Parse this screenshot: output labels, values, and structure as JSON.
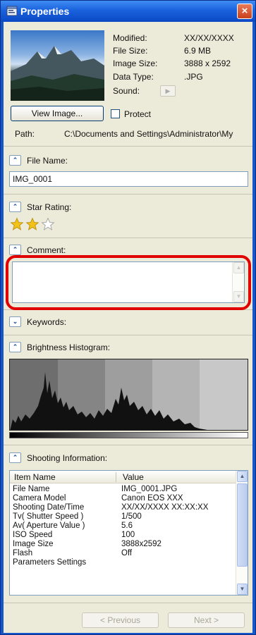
{
  "window": {
    "title": "Properties",
    "close_glyph": "×",
    "icon": "properties-app-icon",
    "accent": "#1656c8"
  },
  "meta": {
    "modified_label": "Modified:",
    "modified_value": "XX/XX/XXXX",
    "filesize_label": "File Size:",
    "filesize_value": "6.9 MB",
    "imagesize_label": "Image Size:",
    "imagesize_value": "3888 x 2592",
    "datatype_label": "Data Type:",
    "datatype_value": ".JPG",
    "sound_label": "Sound:",
    "sound_glyph": "▶"
  },
  "actions": {
    "view_image": "View Image...",
    "protect": "Protect"
  },
  "path": {
    "label": "Path:",
    "value": "C:\\Documents and Settings\\Administrator\\My"
  },
  "sections": {
    "file_name": "File Name:",
    "star_rating": "Star Rating:",
    "comment": "Comment:",
    "keywords": "Keywords:",
    "brightness": "Brightness Histogram:",
    "shooting": "Shooting Information:",
    "collapse_glyph": "⌃",
    "expand_glyph": "⌄"
  },
  "file_name_value": "IMG_0001",
  "star_rating": {
    "value": 2,
    "max": 3
  },
  "comment_value": "",
  "shooting_table": {
    "headers": [
      "Item Name",
      "Value"
    ],
    "rows": [
      [
        "File Name",
        "IMG_0001.JPG"
      ],
      [
        "Camera Model",
        "Canon EOS XXX"
      ],
      [
        "Shooting Date/Time",
        "XX/XX/XXXX XX:XX:XX"
      ],
      [
        "Tv( Shutter Speed )",
        "1/500"
      ],
      [
        "Av( Aperture Value )",
        "5.6"
      ],
      [
        "ISO Speed",
        "100"
      ],
      [
        "Image Size",
        "3888x2592"
      ],
      [
        "Flash",
        "Off"
      ],
      [
        "Parameters Settings",
        ""
      ]
    ]
  },
  "nav": {
    "previous": "< Previous",
    "next": "Next >"
  },
  "colors": {
    "highlight": "#e00000",
    "star": "#f2c21b"
  }
}
